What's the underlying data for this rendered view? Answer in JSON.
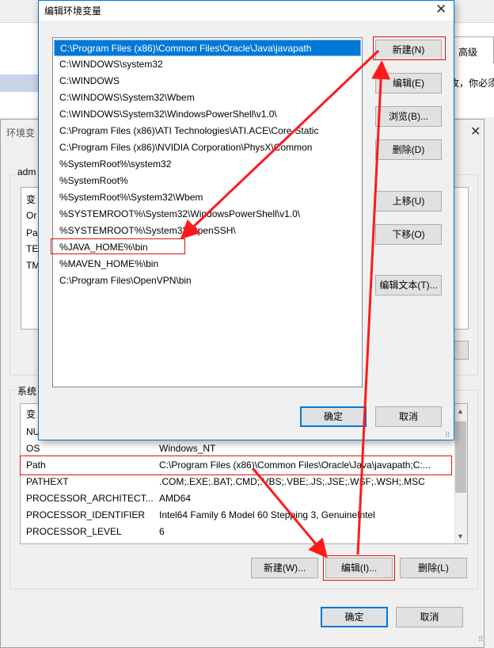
{
  "background": {
    "tab_label": "高级",
    "partial_text": "攻，你必须"
  },
  "env_window": {
    "title_partial": "环境变",
    "user_group_label_partial": "adm",
    "user_rows_partial": [
      "变",
      "Or",
      "Pa",
      "TE",
      "TM"
    ],
    "system_group_label_partial": "系统",
    "system_list": {
      "header_partial": "变",
      "rows": [
        {
          "name": "NU",
          "value": ""
        },
        {
          "name": "OS",
          "value": "Windows_NT"
        },
        {
          "name": "Path",
          "value": "C:\\Program Files (x86)\\Common Files\\Oracle\\Java\\javapath;C:..."
        },
        {
          "name": "PATHEXT",
          "value": ".COM;.EXE;.BAT;.CMD;.VBS;.VBE;.JS;.JSE;.WSF;.WSH;.MSC"
        },
        {
          "name": "PROCESSOR_ARCHITECT...",
          "value": "AMD64"
        },
        {
          "name": "PROCESSOR_IDENTIFIER",
          "value": "Intel64 Family 6 Model 60 Stepping 3, GenuineIntel"
        },
        {
          "name": "PROCESSOR_LEVEL",
          "value": "6"
        }
      ]
    },
    "buttons": {
      "new": "新建(W)...",
      "edit": "编辑(I)...",
      "delete": "删除(L)",
      "ok": "确定",
      "cancel": "取消"
    }
  },
  "edit_dialog": {
    "title": "编辑环境变量",
    "paths": [
      "C:\\Program Files (x86)\\Common Files\\Oracle\\Java\\javapath",
      "C:\\WINDOWS\\system32",
      "C:\\WINDOWS",
      "C:\\WINDOWS\\System32\\Wbem",
      "C:\\WINDOWS\\System32\\WindowsPowerShell\\v1.0\\",
      "C:\\Program Files (x86)\\ATI Technologies\\ATI.ACE\\Core-Static",
      "C:\\Program Files (x86)\\NVIDIA Corporation\\PhysX\\Common",
      "%SystemRoot%\\system32",
      "%SystemRoot%",
      "%SystemRoot%\\System32\\Wbem",
      "%SYSTEMROOT%\\System32\\WindowsPowerShell\\v1.0\\",
      "%SYSTEMROOT%\\System32\\OpenSSH\\",
      "%JAVA_HOME%\\bin",
      "%MAVEN_HOME%\\bin",
      "C:\\Program Files\\OpenVPN\\bin"
    ],
    "buttons": {
      "new": "新建(N)",
      "edit": "编辑(E)",
      "browse": "浏览(B)...",
      "delete": "删除(D)",
      "move_up": "上移(U)",
      "move_down": "下移(O)",
      "edit_text": "编辑文本(T)...",
      "ok": "确定",
      "cancel": "取消"
    }
  },
  "colors": {
    "selection": "#0078d7",
    "annotation": "#e01010"
  }
}
